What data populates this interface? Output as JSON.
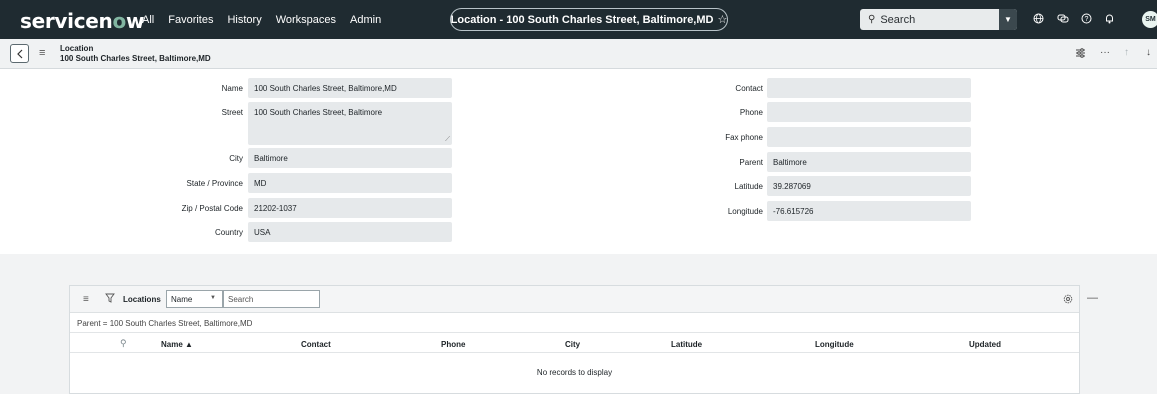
{
  "nav": {
    "logo": "servicenow",
    "logo_parts": [
      "servicen",
      "o",
      "w"
    ],
    "links": [
      "All",
      "Favorites",
      "History",
      "Workspaces",
      "Admin"
    ],
    "context_title": "Location - 100 South Charles Street, Baltimore,MD",
    "search_placeholder": "Search",
    "avatar_initials": "SM",
    "icons": [
      "globe-icon",
      "chat-icon",
      "help-icon",
      "bell-icon"
    ]
  },
  "form_header": {
    "table": "Location",
    "record": "100 South Charles Street, Baltimore,MD"
  },
  "form": {
    "left": [
      {
        "label": "Name",
        "value": "100 South Charles Street, Baltimore,MD"
      },
      {
        "label": "Street",
        "value": "100 South Charles Street, Baltimore"
      },
      {
        "label": "City",
        "value": "Baltimore"
      },
      {
        "label": "State / Province",
        "value": "MD"
      },
      {
        "label": "Zip / Postal Code",
        "value": "21202-1037"
      },
      {
        "label": "Country",
        "value": "USA"
      }
    ],
    "right": [
      {
        "label": "Contact",
        "value": ""
      },
      {
        "label": "Phone",
        "value": ""
      },
      {
        "label": "Fax phone",
        "value": ""
      },
      {
        "label": "Parent",
        "value": "Baltimore"
      },
      {
        "label": "Latitude",
        "value": "39.287069"
      },
      {
        "label": "Longitude",
        "value": "-76.615726"
      }
    ]
  },
  "related_list": {
    "title": "Locations",
    "search_field": "Name",
    "search_placeholder": "Search",
    "breadcrumb": "Parent = 100 South Charles Street, Baltimore,MD",
    "columns": [
      "Name ▲",
      "Contact",
      "Phone",
      "City",
      "Latitude",
      "Longitude",
      "Updated"
    ],
    "empty_message": "No records to display"
  },
  "colors": {
    "nav_bg": "#1f2b31",
    "logo_accent": "#81b5a1",
    "field_bg": "#e6e9eb",
    "section_bg": "#f2f3f4"
  }
}
